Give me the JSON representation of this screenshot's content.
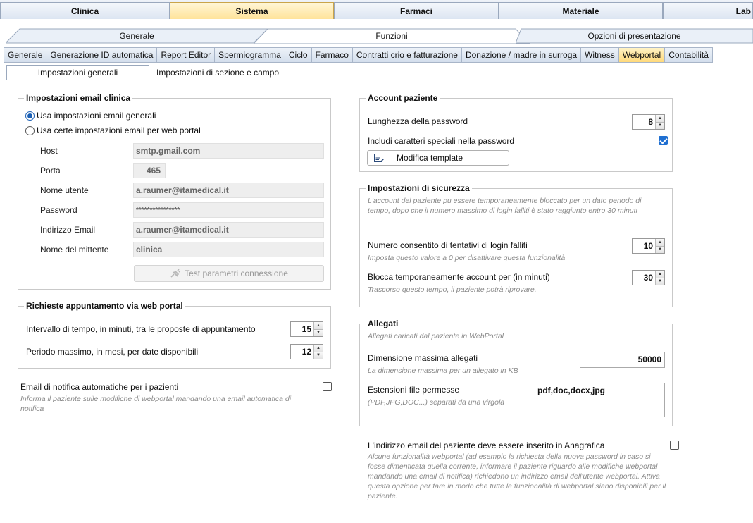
{
  "main_tabs": [
    "Clinica",
    "Sistema",
    "Farmaci",
    "Materiale",
    "Lab"
  ],
  "section_tabs": [
    "Generale",
    "Funzioni",
    "Opzioni di presentazione"
  ],
  "function_tabs": [
    "Generale",
    "Generazione ID automatica",
    "Report Editor",
    "Spermiogramma",
    "Ciclo",
    "Farmaco",
    "Contratti crio e fatturazione",
    "Donazione / madre in surroga",
    "Witness",
    "Webportal",
    "Contabilità"
  ],
  "sub_tabs": [
    "Impostazioni generali",
    "Impostazioni di sezione e campo"
  ],
  "email": {
    "title": "Impostazioni email clinica",
    "radio_general": "Usa impostazioni email generali",
    "radio_custom": "Usa certe impostazioni email per web portal",
    "host_label": "Host",
    "host_value": "smtp.gmail.com",
    "port_label": "Porta",
    "port_value": "465",
    "user_label": "Nome utente",
    "user_value": "a.raumer@itamedical.it",
    "password_label": "Password",
    "password_value": "****************",
    "address_label": "Indirizzo Email",
    "address_value": "a.raumer@itamedical.it",
    "sender_label": "Nome del mittente",
    "sender_value": "clinica",
    "test_button": "Test parametri connessione"
  },
  "appointments": {
    "title": "Richieste appuntamento via web portal",
    "interval_label": "Intervallo di tempo, in minuti, tra le proposte di appuntamento",
    "interval_value": "15",
    "period_label": "Periodo massimo, in mesi, per date disponibili",
    "period_value": "12"
  },
  "notify": {
    "label": "Email di notifica automatiche per i pazienti",
    "hint": "Informa il paziente sulle modifiche di webportal mandando una email automatica di notifica"
  },
  "account": {
    "title": "Account paziente",
    "password_length_label": "Lunghezza della password",
    "password_length_value": "8",
    "special_chars_label": "Includi caratteri speciali nella password",
    "template_button": "Modifica template"
  },
  "security": {
    "title": "Impostazioni di sicurezza",
    "hint": "L'account del paziente pu essere temporaneamente bloccato per un dato periodo di tempo, dopo che il numero massimo di login falliti è stato raggiunto entro 30 minuti",
    "attempts_label": "Numero consentito di tentativi di login falliti",
    "attempts_hint": "Imposta questo valore a 0 per disattivare questa funzionalità",
    "attempts_value": "10",
    "lock_label": "Blocca temporaneamente account per (in minuti)",
    "lock_hint": "Trascorso questo tempo, il paziente potrà riprovare.",
    "lock_value": "30"
  },
  "attachments": {
    "title": "Allegati",
    "hint": "Allegati caricati dal paziente in WebPortal",
    "max_size_label": "Dimensione massima allegati",
    "max_size_hint": "La dimensione massima per un allegato in KB",
    "max_size_value": "50000",
    "extensions_label": "Estensioni file permesse",
    "extensions_hint": "(PDF,JPG,DOC...) separati da una virgola",
    "extensions_value": "pdf,doc,docx,jpg"
  },
  "email_required": {
    "label": "L'indirizzo email del paziente deve essere inserito in Anagrafica",
    "hint": "Alcune funzionalità webportal (ad esempio la richiesta della nuova password in caso si fosse dimenticata quella corrente, informare il paziente riguardo alle modifiche webportal mandando una email di notifica) richiedono un indirizzo email dell'utente webportal. Attiva questa opzione per fare in modo che tutte le funzionalità di webportal siano disponibili per il paziente."
  }
}
